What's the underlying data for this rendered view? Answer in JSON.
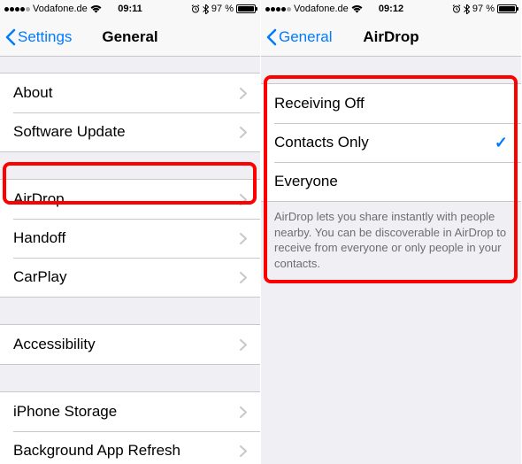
{
  "left": {
    "status": {
      "carrier": "Vodafone.de",
      "time": "09:11",
      "battery_pct": "97 %"
    },
    "nav": {
      "back": "Settings",
      "title": "General"
    },
    "rows": {
      "about": "About",
      "software_update": "Software Update",
      "airdrop": "AirDrop",
      "handoff": "Handoff",
      "carplay": "CarPlay",
      "accessibility": "Accessibility",
      "iphone_storage": "iPhone Storage",
      "background_refresh": "Background App Refresh"
    }
  },
  "right": {
    "status": {
      "carrier": "Vodafone.de",
      "time": "09:12",
      "battery_pct": "97 %"
    },
    "nav": {
      "back": "General",
      "title": "AirDrop"
    },
    "options": {
      "receiving_off": "Receiving Off",
      "contacts_only": "Contacts Only",
      "everyone": "Everyone"
    },
    "footer": "AirDrop lets you share instantly with people nearby. You can be discoverable in AirDrop to receive from everyone or only people in your contacts."
  }
}
